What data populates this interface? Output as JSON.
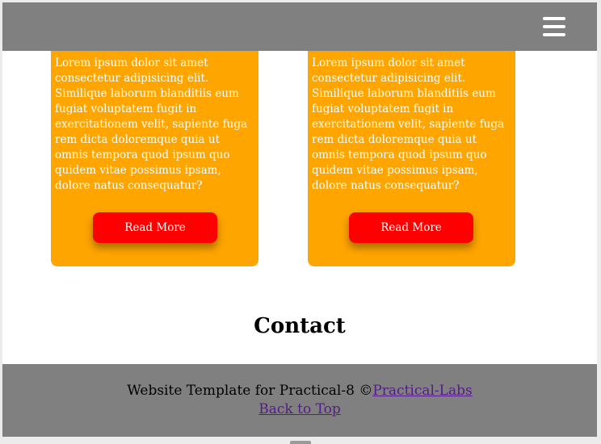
{
  "header": {
    "menu_icon": "hamburger-menu-icon"
  },
  "cards": [
    {
      "text": "Lorem ipsum dolor sit amet consectetur adipisicing elit. Similique laborum blanditiis eum fugiat voluptatem fugit in exercitationem velit, sapiente fuga rem dicta doloremque quia ut omnis tempora quod ipsum quo quidem vitae possimus ipsam, dolore natus consequatur?",
      "button_label": "Read More"
    },
    {
      "text": "Lorem ipsum dolor sit amet consectetur adipisicing elit. Similique laborum blanditiis eum fugiat voluptatem fugit in exercitationem velit, sapiente fuga rem dicta doloremque quia ut omnis tempora quod ipsum quo quidem vitae possimus ipsam, dolore natus consequatur?",
      "button_label": "Read More"
    }
  ],
  "contact": {
    "heading": "Contact"
  },
  "footer": {
    "text": "Website Template for Practical-8 ©",
    "link_label": "Practical-Labs",
    "back_to_top": "Back to Top"
  },
  "colors": {
    "topbar": "#808080",
    "card": "#ffa500",
    "button": "#ff0000",
    "footer": "#808080",
    "link": "#551a8b"
  }
}
